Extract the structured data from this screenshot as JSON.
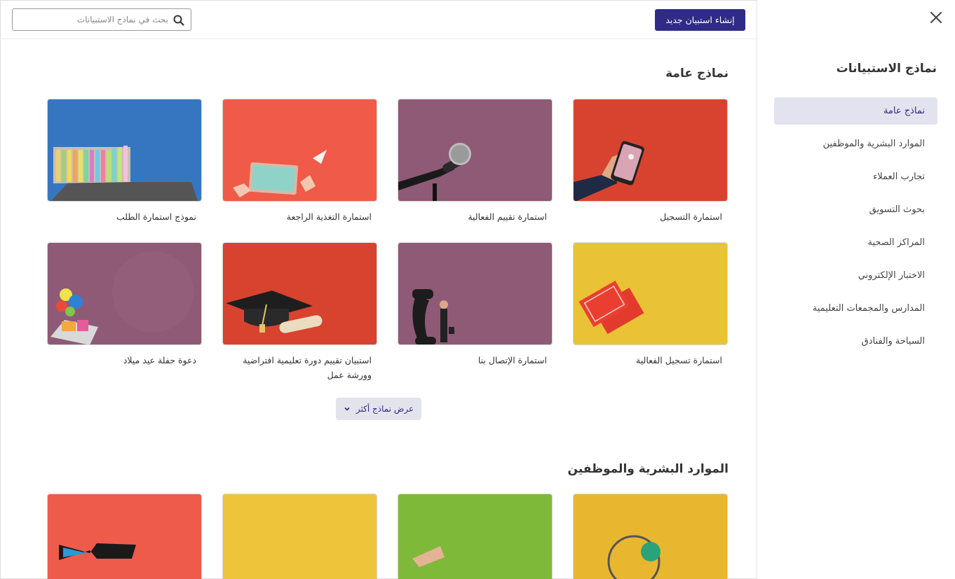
{
  "topbar": {
    "search_placeholder": "بحث في نماذج الاستبيانات",
    "new_survey_label": "إنشاء استبيان جديد"
  },
  "sidebar": {
    "title": "نماذج الاستبيانات",
    "items": [
      {
        "label": "نماذج عامة",
        "active": true
      },
      {
        "label": "الموارد البشرية والموظفين",
        "active": false
      },
      {
        "label": "تجارب العملاء",
        "active": false
      },
      {
        "label": "بحوث التسويق",
        "active": false
      },
      {
        "label": "المراكز الصحية",
        "active": false
      },
      {
        "label": "الاختبار الإلكتروني",
        "active": false
      },
      {
        "label": "المدارس والمجمعات التعليمية",
        "active": false
      },
      {
        "label": "السياحة والفنادق",
        "active": false
      }
    ]
  },
  "sections": [
    {
      "title": "نماذج عامة",
      "cards": [
        {
          "label": "استمارة التسجيل",
          "bg": "#d8432f",
          "icon": "phone-in-hand-icon"
        },
        {
          "label": "استمارة تقييم الفعالية",
          "bg": "#8f5a76",
          "icon": "microphone-icon"
        },
        {
          "label": "استمارة التغذية الراجعة",
          "bg": "#f05a49",
          "icon": "tablet-paper-plane-icon"
        },
        {
          "label": "نموذج استمارة الطلب",
          "bg": "#3676c0",
          "icon": "laptop-folders-icon"
        },
        {
          "label": "استمارة تسجيل الفعالية",
          "bg": "#eac235",
          "icon": "tickets-icon"
        },
        {
          "label": "استمارة الإتصال بنا",
          "bg": "#8f5a76",
          "icon": "telephone-receiver-icon"
        },
        {
          "label": "استبيان تقييم دورة تعليمية افتراضية وورشة عمل",
          "bg": "#d8432f",
          "icon": "graduation-cap-icon"
        },
        {
          "label": "دعوة حفلة عيد ميلاد",
          "bg": "#8f5a76",
          "icon": "birthday-balloons-icon"
        }
      ],
      "more_label": "عرض نماذج أكثر"
    },
    {
      "title": "الموارد البشرية والموظفين",
      "cards": [
        {
          "bg": "#e9b630",
          "icon": "magnifier-icon"
        },
        {
          "bg": "#7fb93a",
          "icon": "hand-icon"
        },
        {
          "bg": "#eec53a",
          "icon": "blank-icon"
        },
        {
          "bg": "#ef5b4b",
          "icon": "bowtie-icon"
        }
      ]
    }
  ]
}
